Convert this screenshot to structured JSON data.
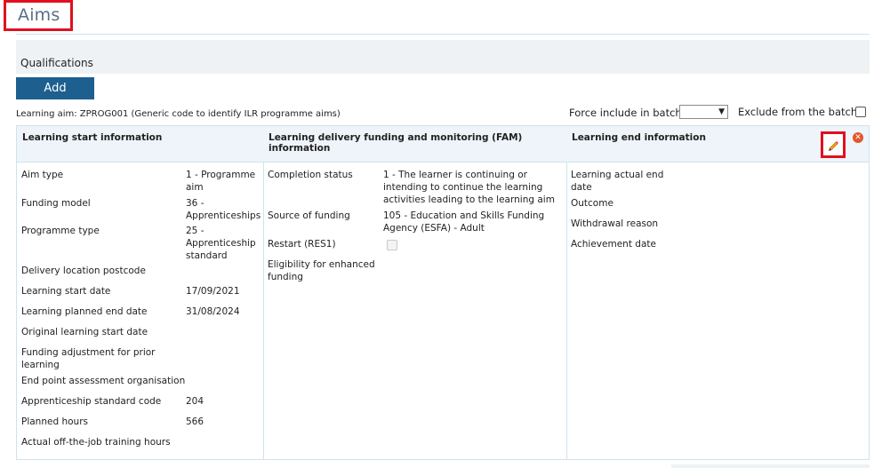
{
  "page": {
    "title": "Aims"
  },
  "qualifications": {
    "label": "Qualifications",
    "add_label": "Add"
  },
  "aim": {
    "title": "Learning aim: ZPROG001 (Generic code to identify ILR programme aims)",
    "force_label": "Force include in batch",
    "force_value": "",
    "exclude_label": "Exclude from the batch",
    "exclude_checked": false
  },
  "columns": {
    "start": "Learning start information",
    "fam": "Learning delivery funding and monitoring (FAM) information",
    "end": "Learning end information"
  },
  "start_info": {
    "aim_type_label": "Aim type",
    "aim_type_value": "1 - Programme aim",
    "funding_model_label": "Funding model",
    "funding_model_value": "36 - Apprenticeships",
    "programme_type_label": "Programme type",
    "programme_type_value": "25 - Apprenticeship standard",
    "delivery_postcode_label": "Delivery location postcode",
    "delivery_postcode_value": "",
    "start_date_label": "Learning start date",
    "start_date_value": "17/09/2021",
    "planned_end_label": "Learning planned end date",
    "planned_end_value": "31/08/2024",
    "orig_start_label": "Original learning start date",
    "funding_adj_label": "Funding adjustment for prior learning",
    "epa_org_label": "End point assessment organisation",
    "std_code_label": "Apprenticeship standard code",
    "std_code_value": "204",
    "planned_hours_label": "Planned hours",
    "planned_hours_value": "566",
    "otj_hours_label": "Actual off-the-job training hours"
  },
  "fam_info": {
    "completion_label": "Completion status",
    "completion_value": "1 - The learner is continuing or intending to continue the learning activities leading to the learning aim",
    "source_label": "Source of funding",
    "source_value": "105 - Education and Skills Funding Agency (ESFA) - Adult",
    "restart_label": "Restart (RES1)",
    "eligibility_label": "Eligibility for enhanced funding"
  },
  "end_info": {
    "actual_end_label": "Learning actual end date",
    "outcome_label": "Outcome",
    "withdrawal_label": "Withdrawal reason",
    "achievement_label": "Achievement date"
  },
  "icons": {
    "edit": "pencil-icon",
    "delete": "close-icon"
  },
  "colors": {
    "accent": "#1d5f8f",
    "highlight": "#e0101f",
    "delete": "#e4562a"
  }
}
